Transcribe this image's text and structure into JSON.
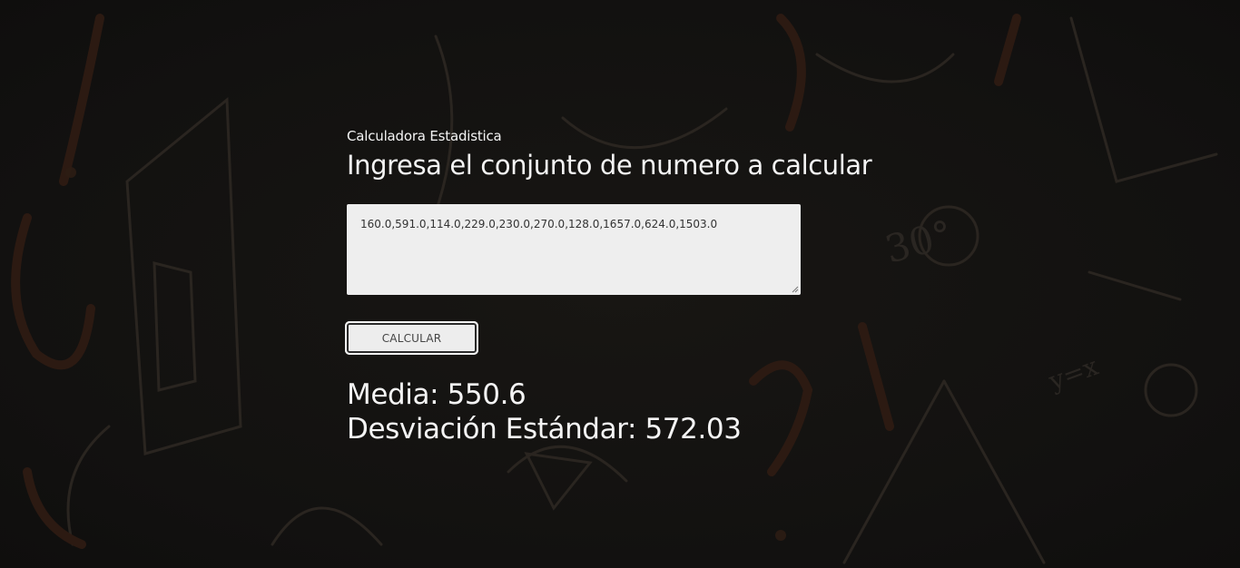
{
  "header": {
    "subtitle": "Calculadora Estadistica",
    "title": "Ingresa el conjunto de numero a calcular"
  },
  "input": {
    "value": "160.0,591.0,114.0,229.0,230.0,270.0,128.0,1657.0,624.0,1503.0"
  },
  "button": {
    "label": "CALCULAR"
  },
  "results": {
    "mean_label": "Media: 550.6",
    "std_label": "Desviación Estándar: 572.03"
  },
  "theme": {
    "background": "#131210",
    "text": "#f4f4f4",
    "input_bg": "#eeeeee"
  }
}
